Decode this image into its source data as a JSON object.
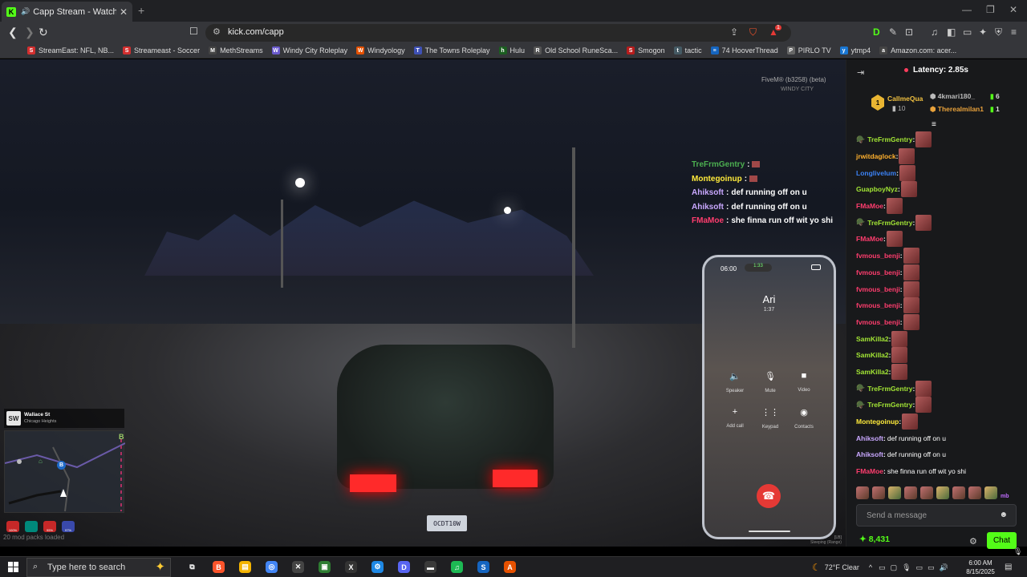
{
  "browser": {
    "tab_title": "Capp Stream - Watch Live on",
    "tab_close": "✕",
    "new_tab": "+",
    "url": "kick.com/capp",
    "shield_badge": "1",
    "bookmarks": [
      {
        "label": "StreamEast: NFL, NB...",
        "icon_letter": "S",
        "color": "#d32f2f"
      },
      {
        "label": "Streameast - Soccer",
        "icon_letter": "S",
        "color": "#d32f2f"
      },
      {
        "label": "MethStreams",
        "icon_letter": "M",
        "color": "#444"
      },
      {
        "label": "Windy City Roleplay",
        "icon_letter": "W",
        "color": "#6a5acd"
      },
      {
        "label": "Windyology",
        "icon_letter": "W",
        "color": "#e65100"
      },
      {
        "label": "The Towns Roleplay",
        "icon_letter": "T",
        "color": "#3f51b5"
      },
      {
        "label": "Hulu",
        "icon_letter": "h",
        "color": "#1b5e20"
      },
      {
        "label": "Old School RuneSca...",
        "icon_letter": "R",
        "color": "#555"
      },
      {
        "label": "Smogon",
        "icon_letter": "S",
        "color": "#b71c1c"
      },
      {
        "label": "tactic",
        "icon_letter": "t",
        "color": "#455a64"
      },
      {
        "label": "74 HooverThread",
        "icon_letter": "≡",
        "color": "#1565c0"
      },
      {
        "label": "PIRLO TV",
        "icon_letter": "P",
        "color": "#666"
      },
      {
        "label": "ytmp4",
        "icon_letter": "y",
        "color": "#1976d2"
      },
      {
        "label": "Amazon.com: acer...",
        "icon_letter": "a",
        "color": "#444"
      }
    ]
  },
  "video": {
    "fivem_label": "FiveM® (b3258) (beta)",
    "city_logo": "WINDY CITY",
    "plate": "OCDT10W",
    "packs_loaded": "20 mod packs loaded",
    "street": {
      "badge": "SW",
      "name": "Wallace St",
      "area": "Chicago Heights"
    },
    "stats": [
      {
        "label": "100%",
        "color": "#c62828"
      },
      {
        "label": "",
        "color": "#00897b"
      },
      {
        "label": "95%",
        "color": "#c62828"
      },
      {
        "label": "97%",
        "color": "#3949ab"
      }
    ],
    "minimap_markers": {
      "b1": "B",
      "b2": "B"
    },
    "overlay_chat": [
      {
        "user": "TreFrmGentry",
        "color": "#4caf50",
        "sep": ":",
        "msg": ""
      },
      {
        "user": "Montegoinup",
        "color": "#ffeb3b",
        "sep": ":",
        "msg": ""
      },
      {
        "user": "Ahiksoft",
        "color": "#c9a8ff",
        "sep": ":",
        "msg": "def running off on u"
      },
      {
        "user": "Ahiksoft",
        "color": "#c9a8ff",
        "sep": ":",
        "msg": "def running off on u"
      },
      {
        "user": "FMaMoe",
        "color": "#ff3d6e",
        "sep": ":",
        "msg": "she finna run off wit yo shi"
      }
    ],
    "phone": {
      "time": "06:00",
      "pill": "1:33",
      "caller": "Ari",
      "duration": "1:37",
      "buttons": [
        {
          "icon": "🔈",
          "label": "Speaker"
        },
        {
          "icon": "🎙",
          "label": "Mute"
        },
        {
          "icon": "■",
          "label": "Video"
        },
        {
          "icon": "+",
          "label": "Add call"
        },
        {
          "icon": "⋮⋮",
          "label": "Keypad"
        },
        {
          "icon": "◉",
          "label": "Contacts"
        }
      ],
      "end_icon": "☎",
      "foot_left": "[LB]",
      "foot_status": "Sleeping (Range)"
    }
  },
  "chat": {
    "latency": "Latency: 2.85s",
    "leaderboard": [
      {
        "name": "CallmeQua",
        "count": "10",
        "color": "#f0c040"
      },
      {
        "name": "4kmari180_",
        "count": "6",
        "color": "#bbb"
      },
      {
        "name": "Therealmilan1",
        "count": "1",
        "color": "#e9a23b"
      }
    ],
    "leader_badge": "1",
    "messages": [
      {
        "user": "TreFrmGentry",
        "color": "#a3e635",
        "hat": true,
        "text": "",
        "emotes": 1
      },
      {
        "user": "jrwitdaglock",
        "color": "#ffb02e",
        "hat": false,
        "text": "",
        "emotes": 1
      },
      {
        "user": "Longlivelum",
        "color": "#3b82f6",
        "hat": false,
        "text": "",
        "emotes": 1
      },
      {
        "user": "GuapboyNyz",
        "color": "#a3e635",
        "hat": false,
        "text": "",
        "emotes": 1
      },
      {
        "user": "FMaMoe",
        "color": "#ff3d6e",
        "hat": false,
        "text": "",
        "emotes": 1
      },
      {
        "user": "TreFrmGentry",
        "color": "#a3e635",
        "hat": true,
        "text": "",
        "emotes": 1
      },
      {
        "user": "FMaMoe",
        "color": "#ff3d6e",
        "hat": false,
        "text": "",
        "emotes": 1
      },
      {
        "user": "fvmous_benji",
        "color": "#ff3d6e",
        "hat": false,
        "text": "",
        "emotes": 1
      },
      {
        "user": "fvmous_benji",
        "color": "#ff3d6e",
        "hat": false,
        "text": "",
        "emotes": 1
      },
      {
        "user": "fvmous_benji",
        "color": "#ff3d6e",
        "hat": false,
        "text": "",
        "emotes": 1
      },
      {
        "user": "fvmous_benji",
        "color": "#ff3d6e",
        "hat": false,
        "text": "",
        "emotes": 1
      },
      {
        "user": "fvmous_benji",
        "color": "#ff3d6e",
        "hat": false,
        "text": "",
        "emotes": 1
      },
      {
        "user": "SamKilla2",
        "color": "#a3e635",
        "hat": false,
        "text": "",
        "emotes": 1
      },
      {
        "user": "SamKilla2",
        "color": "#a3e635",
        "hat": false,
        "text": "",
        "emotes": 1
      },
      {
        "user": "SamKilla2",
        "color": "#a3e635",
        "hat": false,
        "text": "",
        "emotes": 1
      },
      {
        "user": "TreFrmGentry",
        "color": "#a3e635",
        "hat": true,
        "text": "",
        "emotes": 1
      },
      {
        "user": "TreFrmGentry",
        "color": "#a3e635",
        "hat": true,
        "text": "",
        "emotes": 1
      },
      {
        "user": "Montegoinup",
        "color": "#ffeb3b",
        "hat": false,
        "text": "",
        "emotes": 1
      },
      {
        "user": "Ahiksoft",
        "color": "#c9a8ff",
        "hat": false,
        "text": "def running off on u",
        "emotes": 0
      },
      {
        "user": "Ahiksoft",
        "color": "#c9a8ff",
        "hat": false,
        "text": "def running off on u",
        "emotes": 0
      },
      {
        "user": "FMaMoe",
        "color": "#ff3d6e",
        "hat": false,
        "text": "she finna run off wit yo shi",
        "emotes": 0
      }
    ],
    "emote_bar_text": "mb",
    "input_placeholder": "Send a message",
    "kicks": "8,431",
    "send_label": "Chat"
  },
  "taskbar": {
    "search_placeholder": "Type here to search",
    "weather": "72°F Clear",
    "time": "6:00 AM",
    "date": "8/15/2025",
    "apps": [
      {
        "name": "task-view",
        "letter": "⧉",
        "color": "transparent"
      },
      {
        "name": "brave",
        "letter": "B",
        "color": "#fb542b"
      },
      {
        "name": "file-explorer",
        "letter": "▤",
        "color": "#f4b400"
      },
      {
        "name": "chrome",
        "letter": "◎",
        "color": "#4285f4"
      },
      {
        "name": "app-x",
        "letter": "✕",
        "color": "#444"
      },
      {
        "name": "app-green",
        "letter": "▣",
        "color": "#2e7d32"
      },
      {
        "name": "app-x2",
        "letter": "X",
        "color": "#333"
      },
      {
        "name": "app-blue",
        "letter": "⚙",
        "color": "#1e88e5"
      },
      {
        "name": "discord",
        "letter": "D",
        "color": "#5865f2"
      },
      {
        "name": "app-game",
        "letter": "▬",
        "color": "#3a3a3a"
      },
      {
        "name": "spotify",
        "letter": "♫",
        "color": "#1db954"
      },
      {
        "name": "app-s",
        "letter": "S",
        "color": "#1565c0"
      },
      {
        "name": "app-a",
        "letter": "A",
        "color": "#e65100"
      }
    ]
  }
}
